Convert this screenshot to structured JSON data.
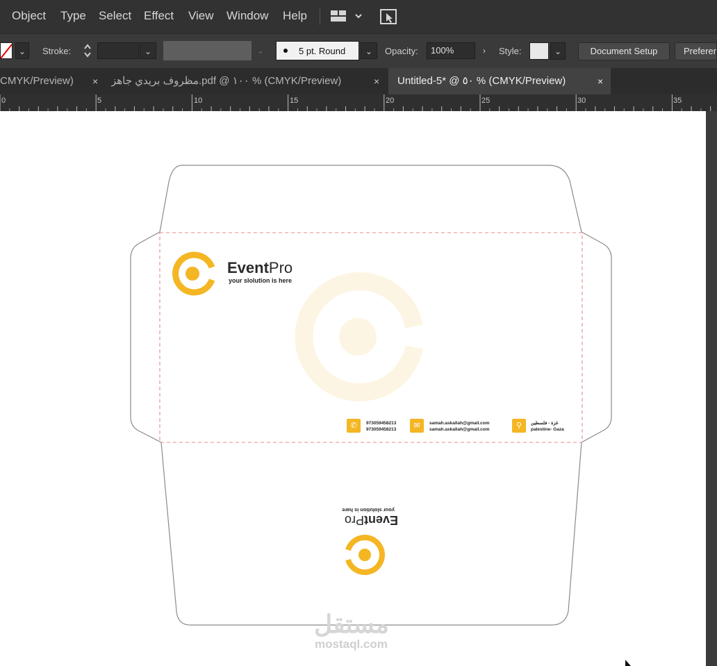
{
  "menu": {
    "items": [
      "Object",
      "Type",
      "Select",
      "Effect",
      "View",
      "Window",
      "Help"
    ],
    "workspace_icon": "grid-layout-icon",
    "gpu_icon": "gpu-preview-icon"
  },
  "control_bar": {
    "stroke_label": "Stroke:",
    "brush_value": "5 pt. Round",
    "opacity_label": "Opacity:",
    "opacity_value": "100%",
    "style_label": "Style:",
    "document_setup": "Document Setup",
    "preferences": "Preferen"
  },
  "tabs": [
    {
      "label": "CMYK/Preview)",
      "active": false
    },
    {
      "label": "مظروف بريدي جاهز.pdf @ ١٠٠ % (CMYK/Preview)",
      "active": false
    },
    {
      "label": "Untitled-5* @ ٥٠ % (CMYK/Preview)",
      "active": true
    }
  ],
  "tab_close_symbol": "×",
  "ruler": {
    "ticks": [
      "0",
      "5",
      "10",
      "15",
      "20",
      "25",
      "30",
      "35"
    ]
  },
  "envelope": {
    "brand_prefix": "Event",
    "brand_suffix": "Pro",
    "tagline": "your slolution is here",
    "phone_1": "973059458213",
    "phone_2": "973059458213",
    "email_1": "samah.askallah@gmail.com",
    "email_2": "samah.askallah@gmail.com",
    "address_ar": "غزة - فلسطين",
    "address_en": "palestine- Gaza",
    "flap_brand_prefix": "Event",
    "flap_brand_suffix": "Pro",
    "flap_tagline": "your slolution is hare",
    "accent_color": "#f4b623"
  },
  "watermark": {
    "arabic": "مستقل",
    "url": "mostaql.com"
  }
}
